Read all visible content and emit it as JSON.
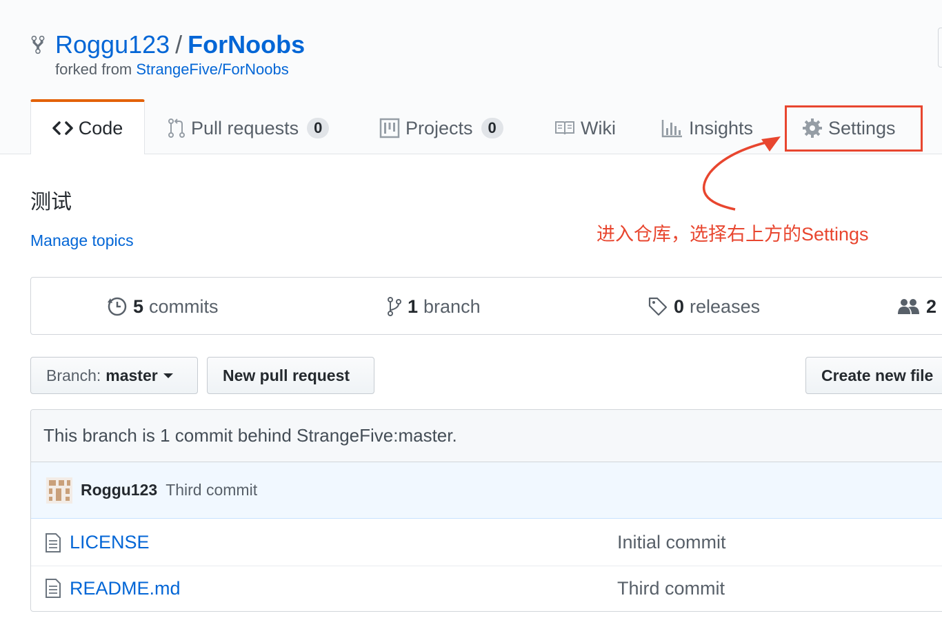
{
  "repo": {
    "owner": "Roggu123",
    "separator": "/",
    "name": "ForNoobs",
    "forked_prefix": "forked from ",
    "forked_source": "StrangeFive/ForNoobs"
  },
  "tabs": {
    "code": "Code",
    "pull_requests": {
      "label": "Pull requests",
      "count": "0"
    },
    "projects": {
      "label": "Projects",
      "count": "0"
    },
    "wiki": "Wiki",
    "insights": "Insights",
    "settings": "Settings"
  },
  "description": "测试",
  "manage_topics": "Manage topics",
  "annotation": {
    "text": "进入仓库，选择右上方的Settings",
    "color": "#e8462f"
  },
  "summary": {
    "commits": {
      "count": "5",
      "label": "commits"
    },
    "branches": {
      "count": "1",
      "label": "branch"
    },
    "releases": {
      "count": "0",
      "label": "releases"
    },
    "contributors": {
      "count": "2"
    }
  },
  "toolbar": {
    "branch_prefix": "Branch:",
    "branch_name": "master",
    "new_pull_request": "New pull request",
    "create_new_file": "Create new file"
  },
  "behind_notice": "This branch is 1 commit behind StrangeFive:master.",
  "latest_commit": {
    "author": "Roggu123",
    "message": "Third commit"
  },
  "files": [
    {
      "name": "LICENSE",
      "message": "Initial commit"
    },
    {
      "name": "README.md",
      "message": "Third commit"
    }
  ],
  "colors": {
    "link": "#0366d6",
    "tab_accent": "#e36209",
    "annotation": "#e8462f"
  }
}
